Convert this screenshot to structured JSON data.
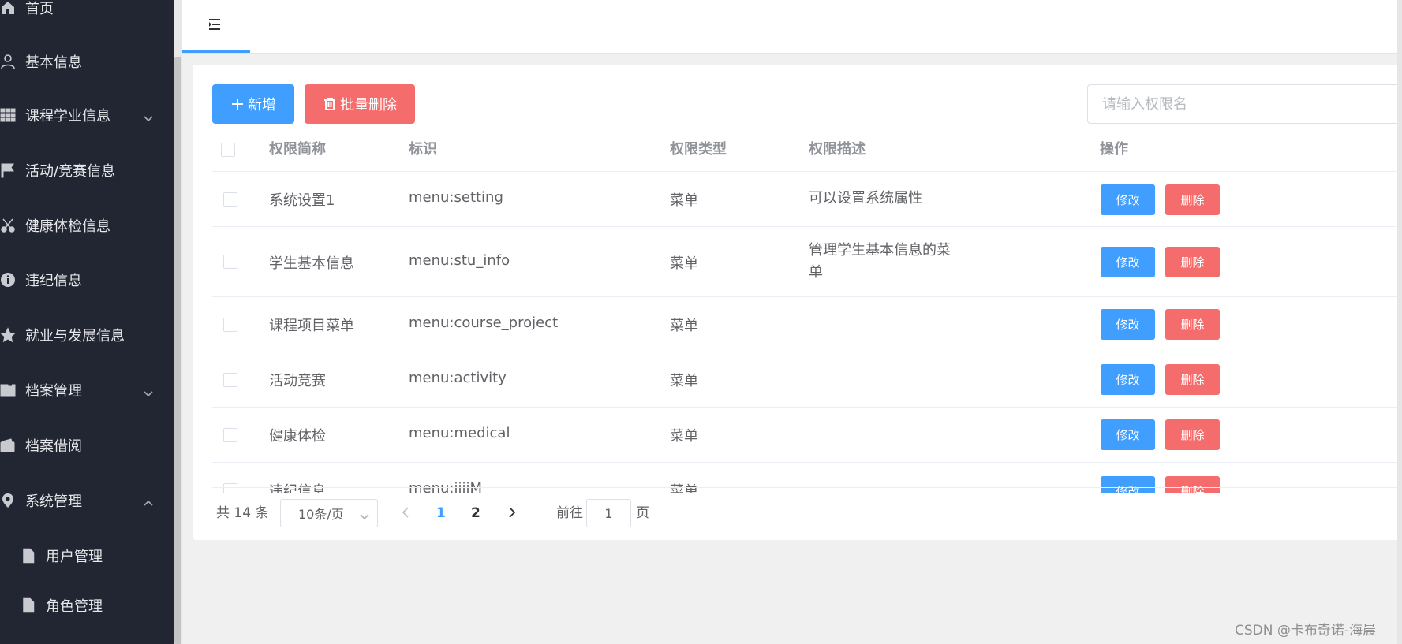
{
  "sidebar": {
    "items": [
      {
        "label": "首页",
        "icon": "home-icon",
        "chevron": ""
      },
      {
        "label": "基本信息",
        "icon": "user-icon",
        "chevron": ""
      },
      {
        "label": "课程学业信息",
        "icon": "grid-icon",
        "chevron": "down"
      },
      {
        "label": "活动/竞赛信息",
        "icon": "flag-icon",
        "chevron": ""
      },
      {
        "label": "健康体检信息",
        "icon": "scissors-icon",
        "chevron": ""
      },
      {
        "label": "违纪信息",
        "icon": "info-icon",
        "chevron": ""
      },
      {
        "label": "就业与发展信息",
        "icon": "star-icon",
        "chevron": ""
      },
      {
        "label": "档案管理",
        "icon": "archive-icon",
        "chevron": "down"
      },
      {
        "label": "档案借阅",
        "icon": "wallet-icon",
        "chevron": ""
      },
      {
        "label": "系统管理",
        "icon": "location-icon",
        "chevron": "up"
      }
    ],
    "sub_items": [
      {
        "label": "用户管理",
        "icon": "document-icon"
      },
      {
        "label": "角色管理",
        "icon": "document-icon"
      }
    ]
  },
  "toolbar": {
    "add_label": "新增",
    "batch_delete_label": "批量删除",
    "search_placeholder": "请输入权限名"
  },
  "table": {
    "headers": {
      "name": "权限简称",
      "key": "标识",
      "type": "权限类型",
      "desc": "权限描述",
      "ops": "操作"
    },
    "rows": [
      {
        "name": "系统设置1",
        "key": "menu:setting",
        "type": "菜单",
        "desc": "可以设置系统属性",
        "edit": "修改",
        "del": "删除"
      },
      {
        "name": "学生基本信息",
        "key": "menu:stu_info",
        "type": "菜单",
        "desc": "管理学生基本信息的菜单",
        "edit": "修改",
        "del": "删除"
      },
      {
        "name": "课程项目菜单",
        "key": "menu:course_project",
        "type": "菜单",
        "desc": "",
        "edit": "修改",
        "del": "删除"
      },
      {
        "name": "活动竞赛",
        "key": "menu:activity",
        "type": "菜单",
        "desc": "",
        "edit": "修改",
        "del": "删除"
      },
      {
        "name": "健康体检",
        "key": "menu:medical",
        "type": "菜单",
        "desc": "",
        "edit": "修改",
        "del": "删除"
      },
      {
        "name": "违纪信息",
        "key": "menu:jijiM",
        "type": "菜单",
        "desc": "",
        "edit": "修改",
        "del": "删除"
      }
    ]
  },
  "pagination": {
    "total": "共 14 条",
    "page_size": "10条/页",
    "pages": [
      "1",
      "2"
    ],
    "current_page": "1",
    "goto_prefix": "前往",
    "goto_value": "1",
    "goto_suffix": "页"
  },
  "watermark": "CSDN @卡布奇诺-海晨",
  "colors": {
    "sidebar_bg": "#222632",
    "primary": "#409eff",
    "danger": "#f56c6c",
    "page_bg": "#f0f0f0"
  }
}
